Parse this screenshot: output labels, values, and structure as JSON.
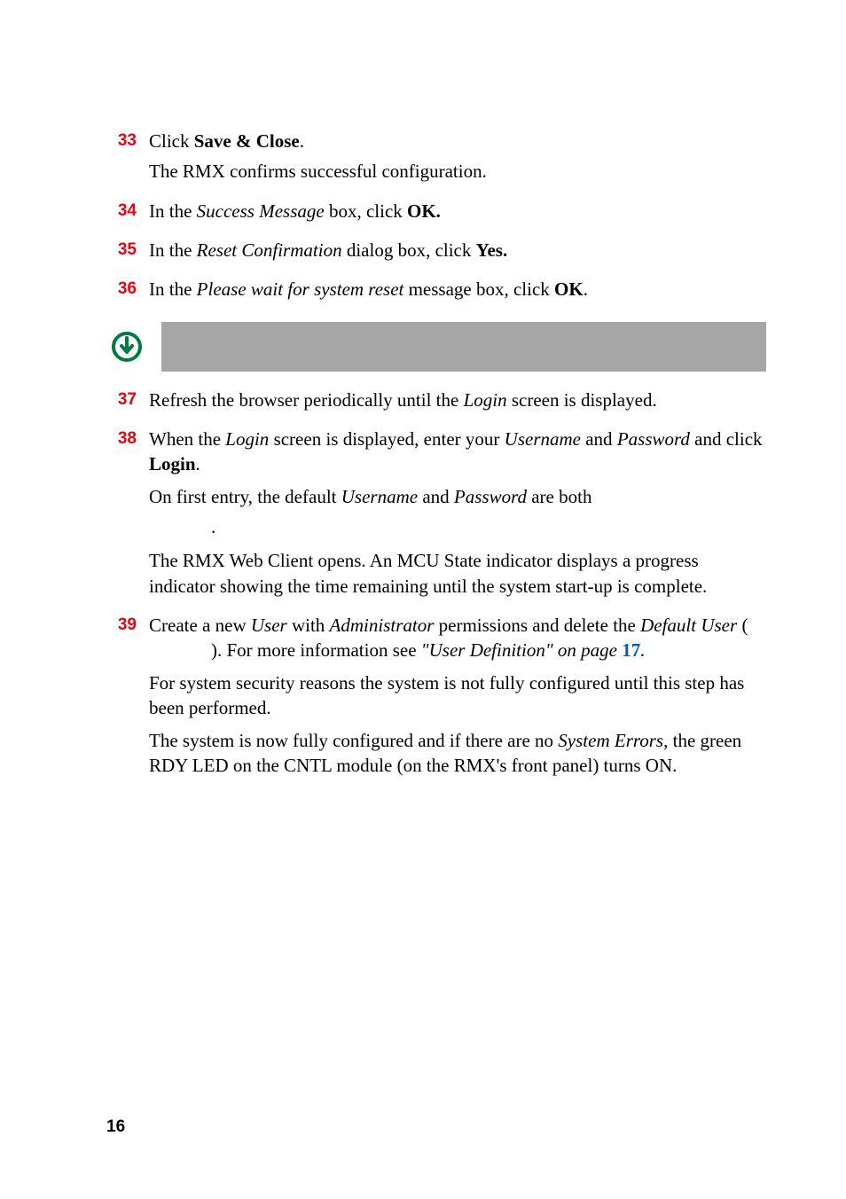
{
  "steps": {
    "s33": {
      "num": "33",
      "t1a": "Click ",
      "t1b": "Save & Close",
      "t1c": ".",
      "t2": "The RMX confirms successful configuration."
    },
    "s34": {
      "num": "34",
      "t1a": "In the ",
      "t1b": "Success Message",
      "t1c": " box, click ",
      "t1d": "OK."
    },
    "s35": {
      "num": "35",
      "t1a": "In the ",
      "t1b": "Reset Confirmation",
      "t1c": " dialog box, click ",
      "t1d": "Yes."
    },
    "s36": {
      "num": "36",
      "t1a": "In the ",
      "t1b": "Please wait for system reset",
      "t1c": " message box, click ",
      "t1d": "OK",
      "t1e": "."
    },
    "s37": {
      "num": "37",
      "t1a": "Refresh the browser periodically until the ",
      "t1b": "Login",
      "t1c": " screen is displayed."
    },
    "s38": {
      "num": "38",
      "t1a": "When the ",
      "t1b": "Login",
      "t1c": " screen is displayed, enter your ",
      "t1d": "Username",
      "t1e": " and ",
      "t1f": "Password",
      "t1g": " and click ",
      "t1h": "Login",
      "t1i": ".",
      "p2a": "On first entry, the default ",
      "p2b": "Username",
      "p2c": " and ",
      "p2d": "Password",
      "p2e": " are both ",
      "p2f": ".",
      "p3": "The RMX Web Client opens. An MCU State indicator displays a progress indicator showing the time remaining until the system start-up is complete."
    },
    "s39": {
      "num": "39",
      "t1a": "Create a new ",
      "t1b": "User",
      "t1c": " with ",
      "t1d": "Administrator",
      "t1e": " permissions and delete the ",
      "t1f": "Default User",
      "t1g": " (",
      "t1h": "). For more information see ",
      "t1i": "\"",
      "t1j": "User Definition\" on page ",
      "t1k": "17",
      "t1l": ".",
      "p2": "For system security reasons the system is not fully configured until this step has been performed.",
      "p3a": "The system is now fully configured and if there are no ",
      "p3b": "System Errors",
      "p3c": ", the green RDY LED on the CNTL module (on the RMX's front panel) turns ON."
    }
  },
  "page_number": "16",
  "icons": {
    "note": "note-arrow-down-circle-icon"
  }
}
